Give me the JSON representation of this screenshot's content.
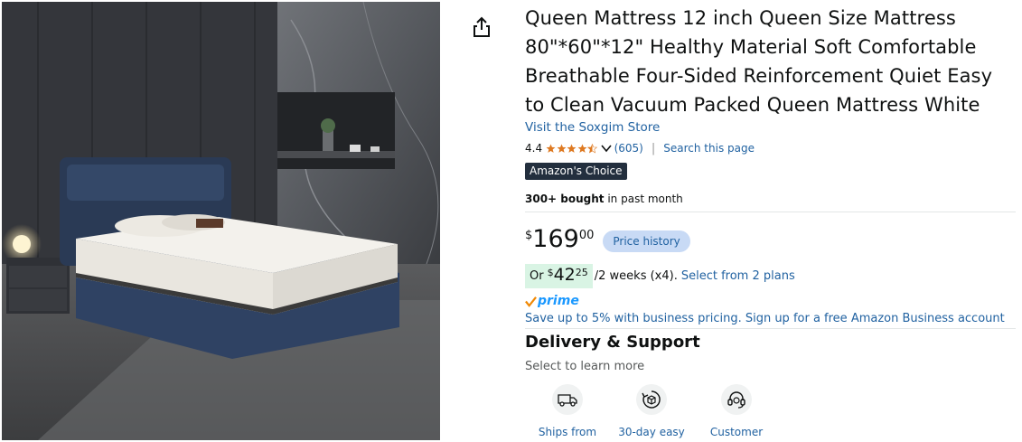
{
  "product": {
    "title": "Queen Mattress 12 inch Queen Size Mattress 80\"*60\"*12\" Healthy Material Soft Comfortable Breathable Four-Sided Reinforcement Quiet Easy to Clean Vacuum Packed Queen Mattress White",
    "store_link": "Visit the Soxgim Store",
    "rating_value": "4.4",
    "rating": 4.4,
    "review_count": "(605)",
    "search_page": "Search this page",
    "badge": "Amazon's Choice",
    "bought_bold": "300+ bought",
    "bought_rest": " in past month"
  },
  "price": {
    "symbol": "$",
    "whole": "169",
    "fraction": "00",
    "history_label": "Price history"
  },
  "installment": {
    "or_label": "Or",
    "symbol": "$",
    "whole": "42",
    "fraction": "25",
    "period": "/2 weeks (x4).",
    "plans_link": "Select from 2 plans"
  },
  "prime": {
    "label": "prime"
  },
  "business": {
    "link": "Save up to 5% with business pricing. Sign up for a free Amazon Business account"
  },
  "delivery": {
    "title": "Delivery & Support",
    "subtitle": "Select to learn more",
    "items": [
      {
        "label": "Ships from",
        "icon": "van-icon"
      },
      {
        "label": "30-day easy",
        "icon": "return-box-icon"
      },
      {
        "label": "Customer",
        "icon": "headset-icon"
      }
    ]
  },
  "colors": {
    "link": "#2162a1",
    "badge_bg": "#232f3e",
    "star": "#de7921",
    "price_history_bg": "#c8daf5",
    "installment_bg": "#d9f4e4",
    "prime": "#1a98ff"
  }
}
